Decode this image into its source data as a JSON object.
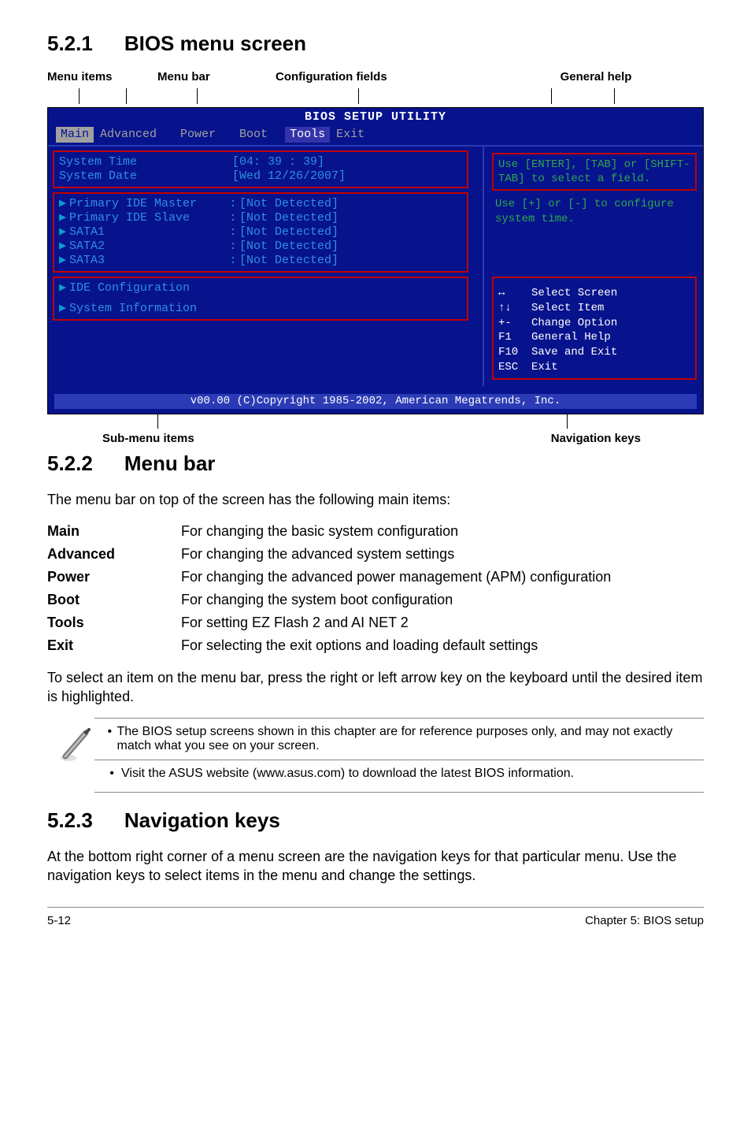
{
  "headings": {
    "s521_num": "5.2.1",
    "s521_title": "BIOS menu screen",
    "s522_num": "5.2.2",
    "s522_title": "Menu bar",
    "s523_num": "5.2.3",
    "s523_title": "Navigation keys"
  },
  "annotations": {
    "top": {
      "menu_items": "Menu items",
      "menu_bar": "Menu bar",
      "config_fields": "Configuration fields",
      "general_help": "General help"
    },
    "bottom": {
      "sub_menu": "Sub-menu items",
      "nav_keys": "Navigation keys"
    }
  },
  "bios": {
    "title": "BIOS SETUP UTILITY",
    "menubar": [
      "Main",
      "Advanced",
      "Power",
      "Boot",
      "Tools",
      "Exit"
    ],
    "active_tab": 0,
    "fields_time": {
      "label": "System Time",
      "value": "[04: 39 : 39]"
    },
    "fields_date": {
      "label": "System Date",
      "value": "[Wed 12/26/2007]"
    },
    "drives": [
      {
        "label": "Primary IDE Master",
        "value": "[Not Detected]"
      },
      {
        "label": "Primary IDE Slave",
        "value": "[Not Detected]"
      },
      {
        "label": "SATA1",
        "value": "[Not Detected]"
      },
      {
        "label": "SATA2",
        "value": "[Not Detected]"
      },
      {
        "label": "SATA3",
        "value": "[Not Detected]"
      }
    ],
    "submenus": [
      "IDE Configuration",
      "System Information"
    ],
    "help1": "Use [ENTER], [TAB] or [SHIFT-TAB] to select a field.",
    "help2": "Use [+] or [-] to configure system time.",
    "keys": [
      {
        "k": "↔",
        "d": "Select Screen"
      },
      {
        "k": "↑↓",
        "d": "Select Item"
      },
      {
        "k": "+-",
        "d": "Change Option"
      },
      {
        "k": "F1",
        "d": "General Help"
      },
      {
        "k": "F10",
        "d": "Save and Exit"
      },
      {
        "k": "ESC",
        "d": "Exit"
      }
    ],
    "footer": "v00.00 (C)Copyright 1985-2002, American Megatrends, Inc."
  },
  "menubar_intro": "The menu bar on top of the screen has the following main items:",
  "menubar_items": [
    {
      "name": "Main",
      "desc": "For changing the basic system configuration"
    },
    {
      "name": "Advanced",
      "desc": "For changing the advanced system settings"
    },
    {
      "name": "Power",
      "desc": "For changing the advanced power management (APM) configuration"
    },
    {
      "name": "Boot",
      "desc": "For changing the system boot configuration"
    },
    {
      "name": "Tools",
      "desc": "For setting EZ Flash 2 and AI NET 2"
    },
    {
      "name": "Exit",
      "desc": "For selecting the exit options and loading default settings"
    }
  ],
  "menubar_select": "To select an item on the menu bar, press the right or left arrow key on the keyboard until the desired item is highlighted.",
  "notes": [
    "The BIOS setup screens shown in this chapter are for reference purposes only, and may not exactly match what you see on your screen.",
    "Visit the ASUS website (www.asus.com) to download the latest BIOS information."
  ],
  "nav_para": "At the bottom right corner of a menu screen are the navigation keys for that particular menu. Use the navigation keys to select items in the menu and change the settings.",
  "page_footer": {
    "left": "5-12",
    "right": "Chapter 5: BIOS setup"
  }
}
